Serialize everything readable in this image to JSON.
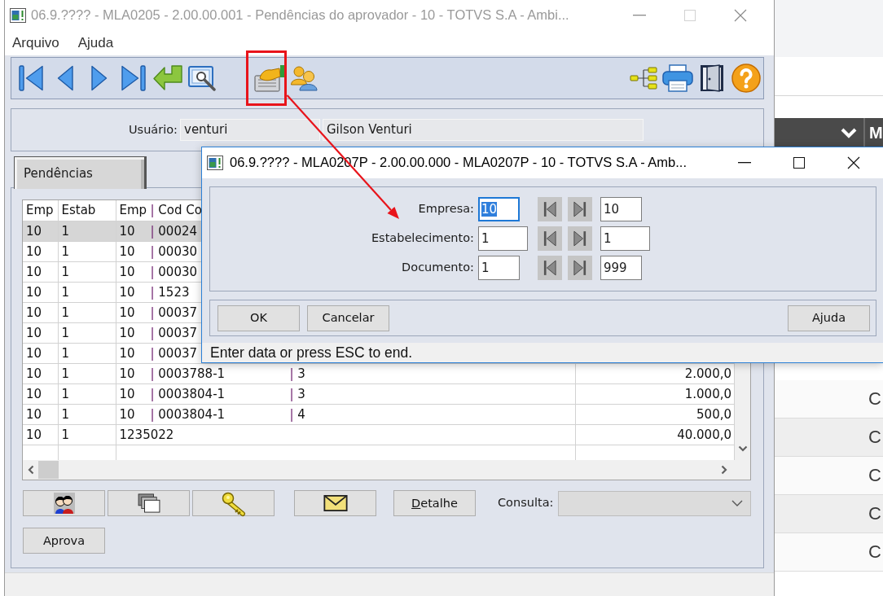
{
  "main_window": {
    "title": "06.9.???? - MLA0205 - 2.00.00.001 - Pendências do aprovador - 10 - TOTVS S.A - Ambi...",
    "active": false,
    "maximize_enabled": false,
    "menu": [
      {
        "label": "Arquivo"
      },
      {
        "label": "Ajuda"
      }
    ],
    "toolbar": [
      [
        {
          "kind": "first",
          "annotated": false
        },
        {
          "kind": "previous",
          "annotated": false
        },
        {
          "kind": "next",
          "annotated": false
        },
        {
          "kind": "last",
          "annotated": false
        },
        {
          "kind": "return",
          "annotated": false
        },
        {
          "kind": "preview",
          "annotated": false
        }
      ],
      [
        {
          "kind": "document-hand",
          "annotated": true
        },
        {
          "kind": "people",
          "annotated": false
        }
      ],
      [
        {
          "kind": "tree",
          "annotated": false
        },
        {
          "kind": "print",
          "annotated": false
        },
        {
          "kind": "exit",
          "annotated": false
        },
        {
          "kind": "help",
          "annotated": false
        }
      ]
    ],
    "user": {
      "label": "Usuário:",
      "login": "venturi",
      "name": "Gilson Venturi"
    },
    "tabs": [
      {
        "label": "Pendências",
        "selected": true
      }
    ],
    "table": {
      "columns": [
        "Emp",
        "Estab",
        [
          "Emp",
          "| Cod Co"
        ]
      ],
      "rows": [
        {
          "cells": [
            "10",
            "1",
            [
              "10",
              "| 00024"
            ]
          ],
          "selected": true
        },
        {
          "cells": [
            "10",
            "1",
            [
              "10",
              "| 00030"
            ]
          ],
          "selected": false
        },
        {
          "cells": [
            "10",
            "1",
            [
              "10",
              "| 00030"
            ]
          ],
          "selected": false
        },
        {
          "cells": [
            "10",
            "1",
            [
              "10",
              "| 1523"
            ]
          ],
          "selected": false
        },
        {
          "cells": [
            "10",
            "1",
            [
              "10",
              "| 00037"
            ]
          ],
          "selected": false
        },
        {
          "cells": [
            "10",
            "1",
            [
              "10",
              "| 00037"
            ]
          ],
          "selected": false
        },
        {
          "cells": [
            "10",
            "1",
            [
              "10",
              "| 00037"
            ]
          ],
          "selected": false
        },
        {
          "cells": [
            "10",
            "1",
            [
              "10",
              "| 0003788-1",
              "| 3"
            ],
            "2.000,0"
          ],
          "selected": false
        },
        {
          "cells": [
            "10",
            "1",
            [
              "10",
              "| 0003804-1",
              "| 3"
            ],
            "1.000,0"
          ],
          "selected": false
        },
        {
          "cells": [
            "10",
            "1",
            [
              "10",
              "| 0003804-1",
              "| 4"
            ],
            "500,0"
          ],
          "selected": false
        },
        {
          "cells": [
            "10",
            "1",
            "1235022",
            "40.000,0"
          ],
          "selected": false
        }
      ]
    },
    "buttons": [
      {
        "kind": "people"
      },
      {
        "kind": "folders"
      },
      {
        "kind": "keys"
      },
      {
        "kind": "mail"
      },
      {
        "kind": "text",
        "label": "Detalhe",
        "mnemonic": true
      }
    ],
    "query": {
      "label": "Consulta:",
      "disabled": true
    },
    "actions": [
      {
        "label": "Aprova"
      }
    ]
  },
  "dialog": {
    "title": "06.9.???? - MLA0207P - 2.00.00.000 - MLA0207P - 10 - TOTVS S.A - Amb...",
    "active": true,
    "maximize_enabled": true,
    "fields": [
      {
        "label": "Empresa:",
        "from": "10",
        "to": "10",
        "focused": true
      },
      {
        "label": "Estabelecimento:",
        "from": "1",
        "to": "1",
        "focused": false
      },
      {
        "label": "Documento:",
        "from": "1",
        "to": "999",
        "focused": false
      }
    ],
    "buttons": [
      {
        "label": "OK"
      },
      {
        "label": "Cancelar"
      }
    ],
    "help_button": {
      "label": "Ajuda"
    },
    "status": "Enter data or press ESC to end."
  },
  "background_window": {
    "header_label": "M",
    "rows": [
      "C",
      "C",
      "C",
      "C",
      "C"
    ]
  }
}
